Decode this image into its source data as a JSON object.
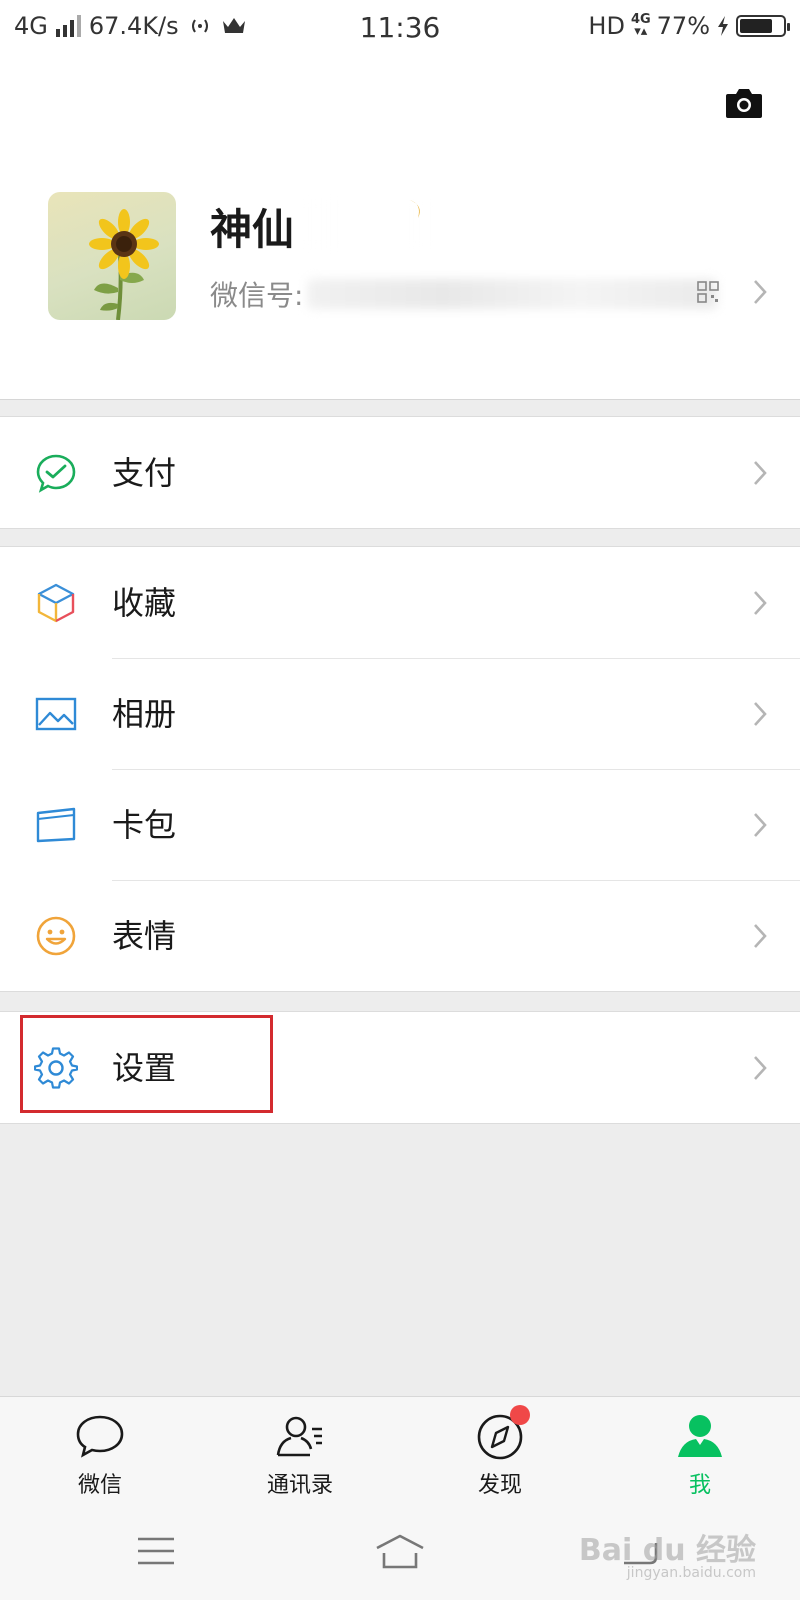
{
  "status_bar": {
    "network": "4G",
    "speed": "67.4K/s",
    "time": "11:36",
    "hd": "HD",
    "network_right": "4G",
    "battery": "77%",
    "battery_level": 0.77
  },
  "profile": {
    "name": "神仙",
    "id_label": "微信号:"
  },
  "menu": {
    "pay": "支付",
    "favorites": "收藏",
    "album": "相册",
    "cards": "卡包",
    "stickers": "表情",
    "settings": "设置"
  },
  "tabs": [
    {
      "label": "微信",
      "icon": "chat-bubble-icon"
    },
    {
      "label": "通讯录",
      "icon": "contacts-icon"
    },
    {
      "label": "发现",
      "icon": "compass-icon"
    },
    {
      "label": "我",
      "icon": "me-person-icon"
    }
  ],
  "colors": {
    "brand_green": "#07c160",
    "highlight_red": "#d32a2f",
    "badge_red": "#f04848"
  },
  "watermark": {
    "brand": "Bai du 经验",
    "url": "jingyan.baidu.com"
  }
}
